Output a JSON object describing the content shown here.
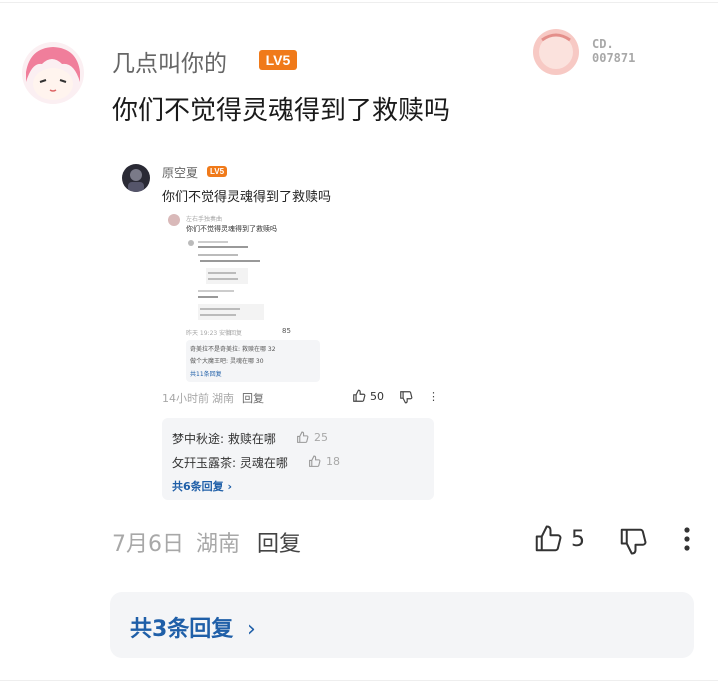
{
  "comment": {
    "username": "几点叫你的",
    "level_badge": "LV5",
    "text": "你们不觉得灵魂得到了救赎吗",
    "date": "7月6日",
    "location": "湖南",
    "reply_label": "回复",
    "like_count": "5",
    "replies_link": "共3条回复",
    "avatar_frame_text": [
      "CD.",
      "007871"
    ]
  },
  "embedded_screenshot": {
    "username": "原空夏",
    "level_badge": "LV5",
    "text": "你们不觉得灵魂得到了救赎吗",
    "nested": {
      "username": "左右手独奏曲",
      "text": "你们不觉得灵魂得到了救赎吗",
      "inner_time": "昨天 19:23 安徽",
      "inner_reply_label": "回复",
      "inner_like_count": "85",
      "replies": [
        {
          "user": "奇美拉不是奇美拉",
          "text": "救赎在哪",
          "likes": "32"
        },
        {
          "user": "做个大魔王吧",
          "text": "灵魂在哪",
          "likes": "30"
        }
      ],
      "replies_link": "共11条回复"
    },
    "time": "14小时前",
    "location": "湖南",
    "reply_label": "回复",
    "like_count": "50",
    "replies": [
      {
        "user": "梦中秋途",
        "text": "救赎在哪",
        "likes": "25"
      },
      {
        "user": "攵幵玉露茶",
        "text": "灵魂在哪",
        "likes": "18"
      }
    ],
    "replies_link": "共6条回复"
  },
  "colors": {
    "accent_blue": "#1f5fa8",
    "level_orange": "#f07a1a",
    "muted_gray": "#a8a8a8"
  }
}
